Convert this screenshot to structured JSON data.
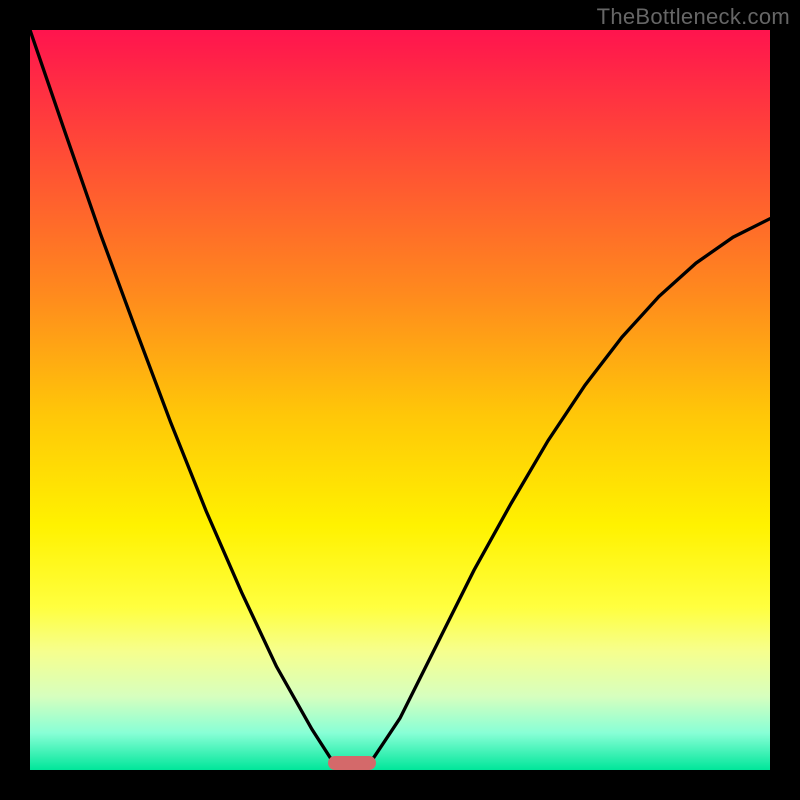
{
  "watermark": "TheBottleneck.com",
  "colors": {
    "background": "#000000",
    "curve": "#000000",
    "pill": "#d4696a",
    "watermark": "#666666"
  },
  "chart_data": {
    "type": "line",
    "title": "",
    "xlabel": "",
    "ylabel": "",
    "xlim": [
      0,
      100
    ],
    "ylim": [
      0,
      100
    ],
    "note": "No axis ticks or numeric labels are rendered. x and y are in percent of the plot area (0,0 = bottom-left). Values estimated from gridlines implied by the square.",
    "series": [
      {
        "name": "left-curve",
        "x": [
          0.0,
          4.8,
          9.5,
          14.3,
          19.0,
          23.8,
          28.6,
          33.3,
          38.1,
          41.0
        ],
        "y": [
          100.0,
          86.0,
          72.5,
          59.5,
          47.0,
          35.0,
          24.0,
          14.0,
          5.5,
          1.0
        ]
      },
      {
        "name": "right-curve",
        "x": [
          46.0,
          50.0,
          55.0,
          60.0,
          65.0,
          70.0,
          75.0,
          80.0,
          85.0,
          90.0,
          95.0,
          100.0
        ],
        "y": [
          1.0,
          7.0,
          17.0,
          27.0,
          36.0,
          44.5,
          52.0,
          58.5,
          64.0,
          68.5,
          72.0,
          74.5
        ]
      }
    ],
    "marker": {
      "name": "bottom-pill",
      "x": 43.5,
      "y": 1.0
    },
    "background_gradient_stops": [
      {
        "pos": 0.0,
        "color": "#ff144e"
      },
      {
        "pos": 0.18,
        "color": "#ff5034"
      },
      {
        "pos": 0.36,
        "color": "#ff8b1d"
      },
      {
        "pos": 0.52,
        "color": "#ffc708"
      },
      {
        "pos": 0.67,
        "color": "#fff200"
      },
      {
        "pos": 0.78,
        "color": "#ffff3f"
      },
      {
        "pos": 0.84,
        "color": "#f6ff8e"
      },
      {
        "pos": 0.9,
        "color": "#d7ffbe"
      },
      {
        "pos": 0.95,
        "color": "#88ffd6"
      },
      {
        "pos": 1.0,
        "color": "#00e69a"
      }
    ]
  }
}
